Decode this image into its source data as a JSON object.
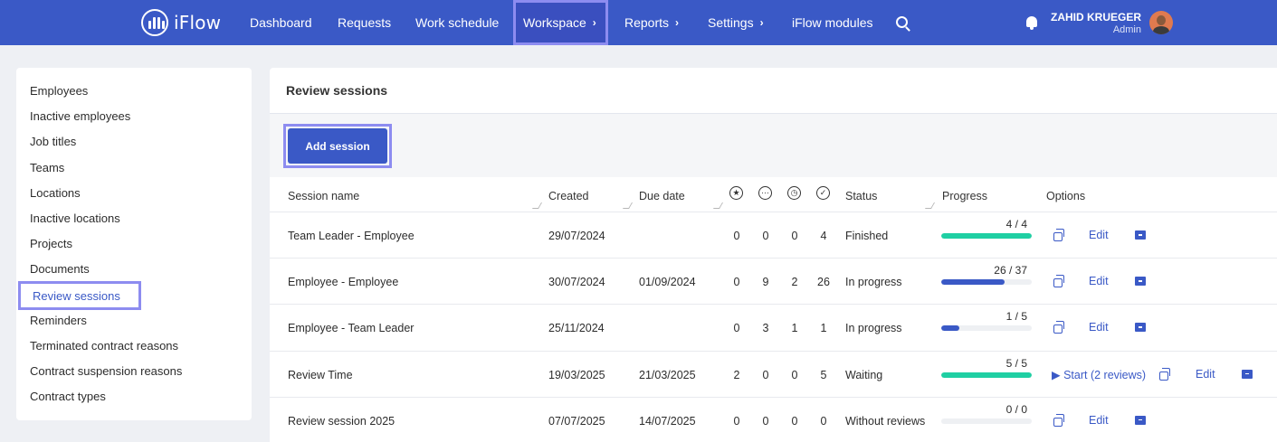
{
  "app": {
    "name": "iFlow"
  },
  "nav": {
    "items": [
      {
        "label": "Dashboard",
        "chevron": false
      },
      {
        "label": "Requests",
        "chevron": false
      },
      {
        "label": "Work schedule",
        "chevron": false
      },
      {
        "label": "Workspace",
        "chevron": true,
        "active": true
      },
      {
        "label": "Reports",
        "chevron": true
      },
      {
        "label": "Settings",
        "chevron": true
      },
      {
        "label": "iFlow modules",
        "chevron": false
      }
    ],
    "chevron_glyph": "›"
  },
  "user": {
    "name": "ZAHID KRUEGER",
    "role": "Admin"
  },
  "sidebar": {
    "items": [
      "Employees",
      "Inactive employees",
      "Job titles",
      "Teams",
      "Locations",
      "Inactive locations",
      "Projects",
      "Documents",
      "Review sessions",
      "Reminders",
      "Terminated contract reasons",
      "Contract suspension reasons",
      "Contract types"
    ],
    "active": "Review sessions"
  },
  "main": {
    "title": "Review sessions",
    "add_button": "Add session",
    "columns": {
      "session_name": "Session name",
      "created": "Created",
      "due_date": "Due date",
      "status": "Status",
      "progress": "Progress",
      "options": "Options"
    },
    "count_icons": [
      "star-icon",
      "dots-icon",
      "clock-icon",
      "check-icon"
    ],
    "edit_label": "Edit",
    "rows": [
      {
        "name": "Team Leader - Employee",
        "created": "29/07/2024",
        "due": "",
        "c1": "0",
        "c2": "0",
        "c3": "0",
        "c4": "4",
        "status": "Finished",
        "progress_label": "4 / 4",
        "progress": 1.0,
        "progress_color": "#1fcfa3",
        "start": ""
      },
      {
        "name": "Employee - Employee",
        "created": "30/07/2024",
        "due": "01/09/2024",
        "c1": "0",
        "c2": "9",
        "c3": "2",
        "c4": "26",
        "status": "In progress",
        "progress_label": "26 / 37",
        "progress": 0.703,
        "progress_color": "#3a59c6",
        "start": ""
      },
      {
        "name": "Employee - Team Leader",
        "created": "25/11/2024",
        "due": "",
        "c1": "0",
        "c2": "3",
        "c3": "1",
        "c4": "1",
        "status": "In progress",
        "progress_label": "1 / 5",
        "progress": 0.2,
        "progress_color": "#3a59c6",
        "start": ""
      },
      {
        "name": "Review Time",
        "created": "19/03/2025",
        "due": "21/03/2025",
        "c1": "2",
        "c2": "0",
        "c3": "0",
        "c4": "5",
        "status": "Waiting",
        "progress_label": "5 / 5",
        "progress": 1.0,
        "progress_color": "#1fcfa3",
        "start": "▶ Start  (2 reviews)"
      },
      {
        "name": "Review session 2025",
        "created": "07/07/2025",
        "due": "14/07/2025",
        "c1": "0",
        "c2": "0",
        "c3": "0",
        "c4": "0",
        "status": "Without reviews",
        "progress_label": "0 / 0",
        "progress": 0,
        "progress_color": "#3a59c6",
        "start": ""
      }
    ]
  }
}
